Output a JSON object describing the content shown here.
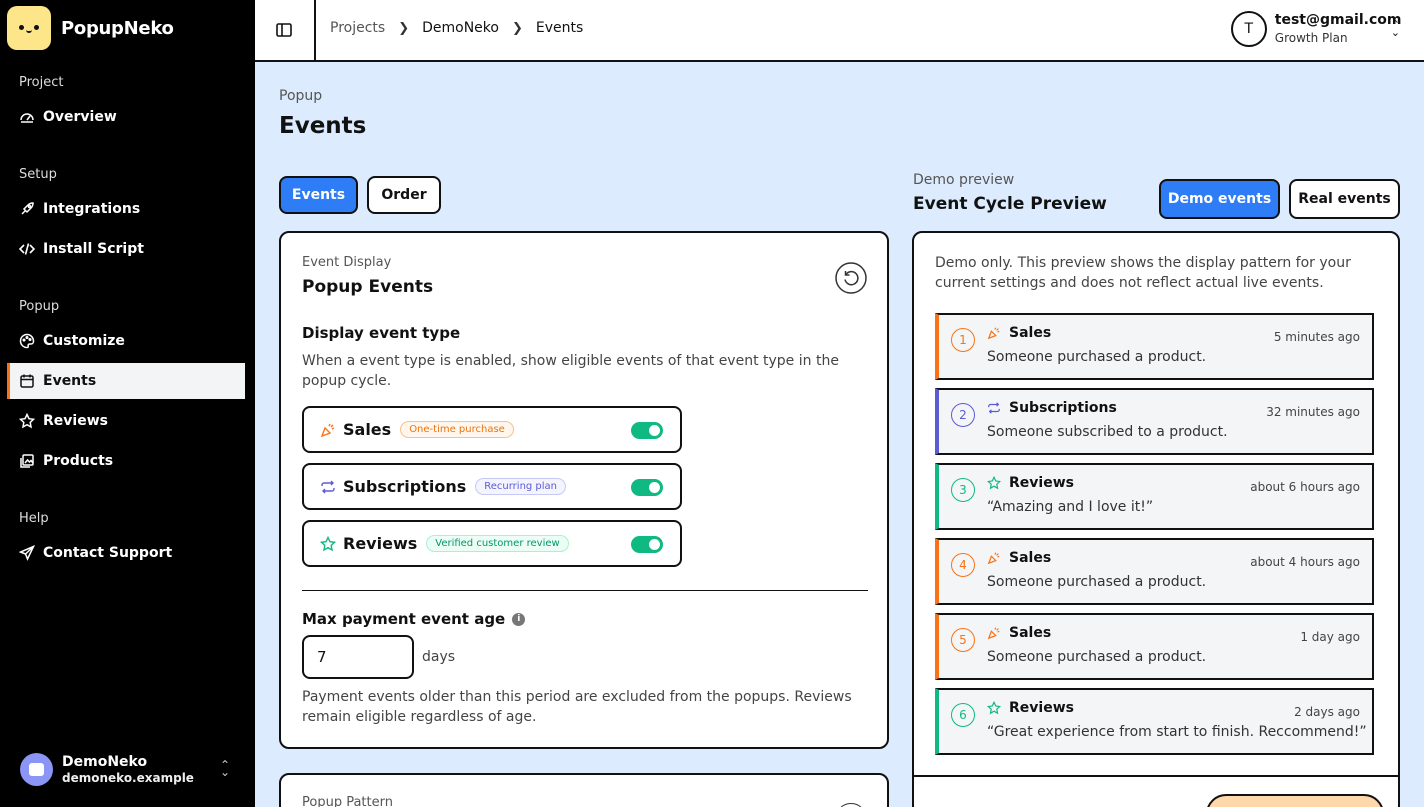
{
  "app": {
    "name": "PopupNeko"
  },
  "sidebar": {
    "sections": [
      {
        "label": "Project"
      },
      {
        "label": "Setup"
      },
      {
        "label": "Popup"
      },
      {
        "label": "Help"
      }
    ],
    "items": [
      {
        "label": "Overview",
        "icon": "gauge-icon"
      },
      {
        "label": "Integrations",
        "icon": "rocket-icon"
      },
      {
        "label": "Install Script",
        "icon": "code-icon"
      },
      {
        "label": "Customize",
        "icon": "palette-icon"
      },
      {
        "label": "Events",
        "icon": "calendar-icon",
        "active": true
      },
      {
        "label": "Reviews",
        "icon": "star-icon"
      },
      {
        "label": "Products",
        "icon": "image-icon"
      },
      {
        "label": "Contact Support",
        "icon": "send-icon"
      }
    ],
    "project": {
      "name": "DemoNeko",
      "domain": "demoneko.example"
    }
  },
  "topbar": {
    "breadcrumb": [
      "Projects",
      "DemoNeko",
      "Events"
    ],
    "account": {
      "initial": "T",
      "email": "test@gmail.com",
      "plan": "Growth Plan"
    }
  },
  "page": {
    "section": "Popup",
    "title": "Events"
  },
  "tabs": {
    "events": "Events",
    "order": "Order"
  },
  "display_card": {
    "label": "Event Display",
    "title": "Popup Events",
    "type_heading": "Display event type",
    "type_desc": "When a event type is enabled, show eligible events of that event type in the popup cycle.",
    "types": [
      {
        "name": "Sales",
        "badge": "One-time purchase",
        "enabled": true,
        "icon": "party-popper-icon"
      },
      {
        "name": "Subscriptions",
        "badge": "Recurring plan",
        "enabled": true,
        "icon": "repeat-icon"
      },
      {
        "name": "Reviews",
        "badge": "Verified customer review",
        "enabled": true,
        "icon": "star-icon"
      }
    ],
    "max_age": {
      "label": "Max payment event age",
      "value": "7",
      "unit": "days",
      "help": "Payment events older than this period are excluded from the popups. Reviews remain eligible regardless of age."
    }
  },
  "pattern_card": {
    "label": "Popup Pattern"
  },
  "preview": {
    "label": "Demo preview",
    "title": "Event Cycle Preview",
    "demo_btn": "Demo events",
    "real_btn": "Real events",
    "note": "Demo only. This preview shows the display pattern for your current settings and does not reflect actual live events.",
    "events": [
      {
        "num": "1",
        "type": "Sales",
        "time": "5 minutes ago",
        "desc": "Someone purchased a product."
      },
      {
        "num": "2",
        "type": "Subscriptions",
        "time": "32 minutes ago",
        "desc": "Someone subscribed to a product."
      },
      {
        "num": "3",
        "type": "Reviews",
        "time": "about 6 hours ago",
        "desc": "“Amazing and I love it!”"
      },
      {
        "num": "4",
        "type": "Sales",
        "time": "about 4 hours ago",
        "desc": "Someone purchased a product."
      },
      {
        "num": "5",
        "type": "Sales",
        "time": "1 day ago",
        "desc": "Someone purchased a product."
      },
      {
        "num": "6",
        "type": "Reviews",
        "time": "2 days ago",
        "desc": "“Great experience from start to finish. Reccommend!”"
      }
    ]
  },
  "colors": {
    "accent": "#2f7df6",
    "sales": "#f97316",
    "subscriptions": "#5b5bd6",
    "reviews": "#10b981",
    "background": "#dcebfd"
  }
}
